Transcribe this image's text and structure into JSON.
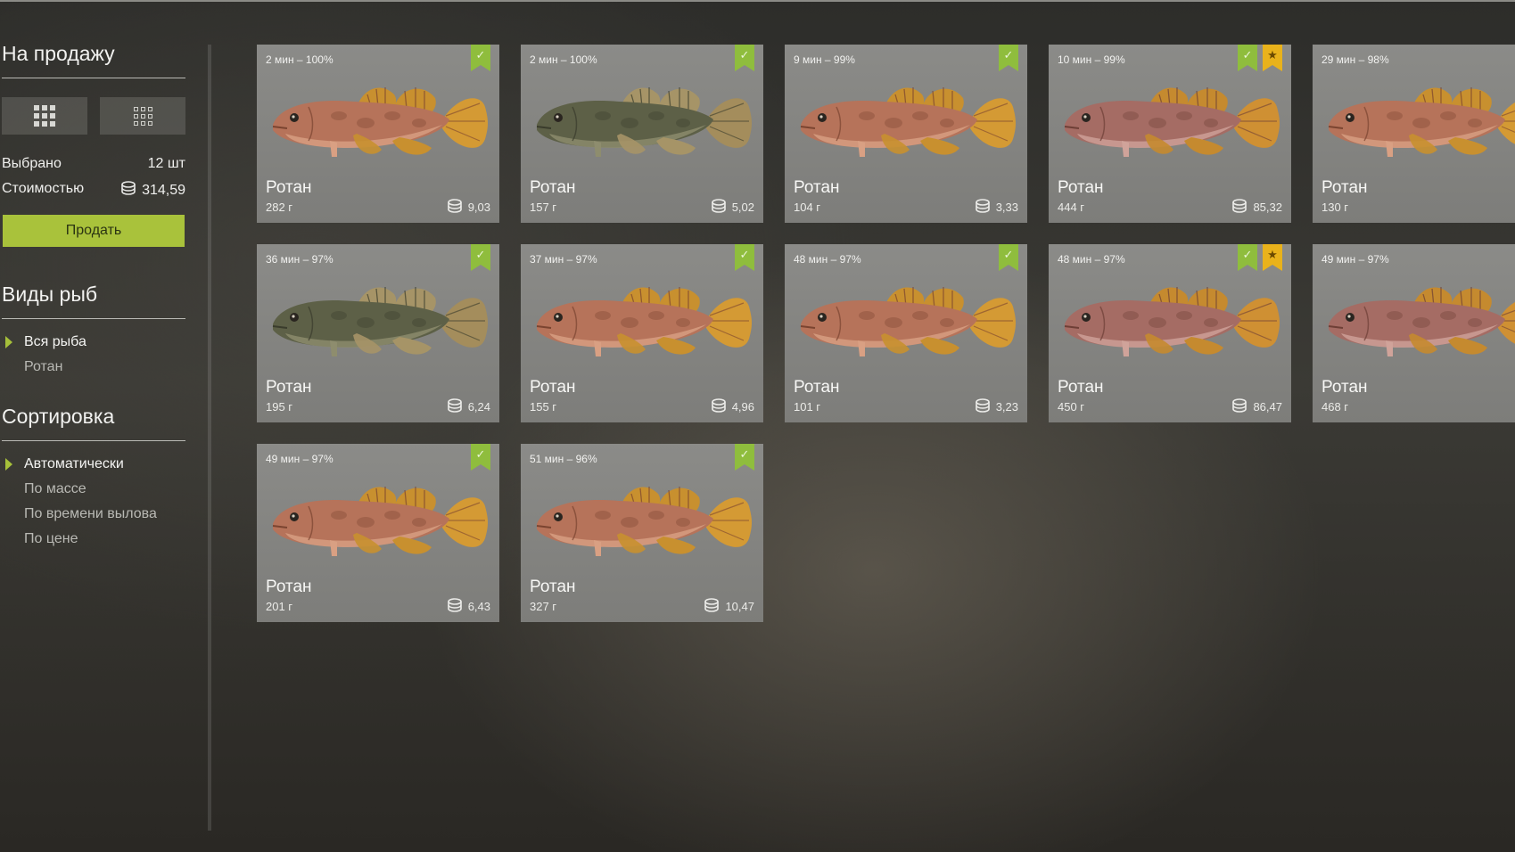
{
  "sidebar": {
    "for_sale_title": "На продажу",
    "selected_label": "Выбрано",
    "selected_value": "12 шт",
    "cost_label": "Стоимостью",
    "cost_value": "314,59",
    "sell_button": "Продать",
    "species_title": "Виды рыб",
    "species": [
      {
        "label": "Вся рыба",
        "active": true
      },
      {
        "label": "Ротан",
        "active": false
      }
    ],
    "sort_title": "Сортировка",
    "sort_options": [
      {
        "label": "Автоматически",
        "active": true
      },
      {
        "label": "По массе",
        "active": false
      },
      {
        "label": "По времени вылова",
        "active": false
      },
      {
        "label": "По цене",
        "active": false
      }
    ]
  },
  "cards": [
    {
      "time": "2 мин – 100%",
      "name": "Ротан",
      "weight": "282 г",
      "price": "9,03",
      "color": "orange",
      "star": false
    },
    {
      "time": "2 мин – 100%",
      "name": "Ротан",
      "weight": "157 г",
      "price": "5,02",
      "color": "dark",
      "star": false
    },
    {
      "time": "9 мин – 99%",
      "name": "Ротан",
      "weight": "104 г",
      "price": "3,33",
      "color": "orange",
      "star": false
    },
    {
      "time": "10 мин – 99%",
      "name": "Ротан",
      "weight": "444 г",
      "price": "85,32",
      "color": "red",
      "star": true
    },
    {
      "time": "29 мин – 98%",
      "name": "Ротан",
      "weight": "130 г",
      "price": "",
      "color": "orange",
      "star": false
    },
    {
      "time": "36 мин – 97%",
      "name": "Ротан",
      "weight": "195 г",
      "price": "6,24",
      "color": "dark",
      "star": false
    },
    {
      "time": "37 мин – 97%",
      "name": "Ротан",
      "weight": "155 г",
      "price": "4,96",
      "color": "orange",
      "star": false
    },
    {
      "time": "48 мин – 97%",
      "name": "Ротан",
      "weight": "101 г",
      "price": "3,23",
      "color": "orange",
      "star": false
    },
    {
      "time": "48 мин – 97%",
      "name": "Ротан",
      "weight": "450 г",
      "price": "86,47",
      "color": "red",
      "star": true
    },
    {
      "time": "49 мин – 97%",
      "name": "Ротан",
      "weight": "468 г",
      "price": "",
      "color": "red",
      "star": false
    },
    {
      "time": "49 мин – 97%",
      "name": "Ротан",
      "weight": "201 г",
      "price": "6,43",
      "color": "orange",
      "star": false
    },
    {
      "time": "51 мин – 96%",
      "name": "Ротан",
      "weight": "327 г",
      "price": "10,47",
      "color": "orange",
      "star": false
    }
  ],
  "colors": {
    "accent": "#a9c23b",
    "check_badge": "#8fbd3d",
    "star_badge": "#e9b21b",
    "card_bg": "#858582"
  }
}
